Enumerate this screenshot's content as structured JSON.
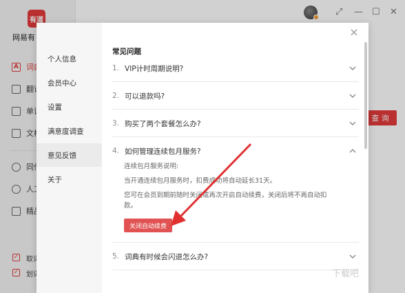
{
  "app": {
    "logo_text": "有道",
    "name": "网易有",
    "nav": [
      {
        "label": "词典",
        "icon": "dictionary-icon",
        "glyph": "A"
      },
      {
        "label": "翻译",
        "icon": "translate-icon"
      },
      {
        "label": "单词",
        "icon": "wordbook-icon"
      },
      {
        "label": "文档",
        "icon": "document-icon"
      },
      {
        "label": "同传",
        "icon": "interpretation-icon"
      },
      {
        "label": "人工",
        "icon": "human-translate-icon"
      },
      {
        "label": "精品",
        "icon": "course-icon"
      }
    ],
    "options": [
      {
        "label": "取词",
        "checked": "✓"
      },
      {
        "label": "划词",
        "checked": "✓"
      }
    ],
    "search_button": "查 询",
    "window_controls": {
      "restore": "⤢",
      "minimize": "—",
      "maximize": "☐",
      "close": "✕"
    }
  },
  "dialog": {
    "close": "×",
    "nav": [
      {
        "label": "个人信息"
      },
      {
        "label": "会员中心"
      },
      {
        "label": "设置"
      },
      {
        "label": "满意度调查"
      },
      {
        "label": "意见反馈"
      },
      {
        "label": "关于"
      }
    ],
    "active_nav": "意见反馈",
    "faq": {
      "title": "常见问题",
      "items": [
        {
          "num": "1.",
          "question": "VIP计时周期说明?"
        },
        {
          "num": "2.",
          "question": "可以退款吗?"
        },
        {
          "num": "3.",
          "question": "购买了两个套餐怎么办?"
        },
        {
          "num": "4.",
          "question": "如何管理连续包月服务?",
          "answer": {
            "line1": "连续包月服务说明:",
            "line2": "当开通连续包月服务时，扣费成功将自动延长31天。",
            "line3": "您可在会员到期前随时关闭或再次开启自动续费，关闭后将不再自动扣",
            "line4": "款。",
            "button": "关闭自动续费"
          }
        },
        {
          "num": "5.",
          "question": "词典有时候会闪退怎么办?"
        }
      ]
    }
  },
  "colors": {
    "accent": "#e33b3b",
    "button": "#e15252"
  },
  "watermark": "下载吧"
}
